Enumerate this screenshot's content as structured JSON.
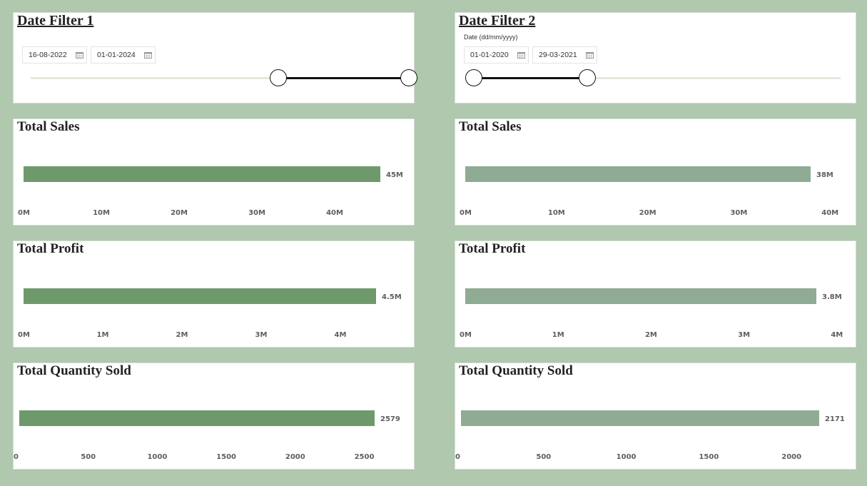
{
  "filters": [
    {
      "title": "Date Filter 1",
      "caption": "",
      "start_date": "16-08-2022",
      "end_date": "01-01-2024",
      "range_fraction": [
        0.655,
        1.0
      ]
    },
    {
      "title": "Date Filter 2",
      "caption": "Date (dd/mm/yyyy)",
      "start_date": "01-01-2020",
      "end_date": "29-03-2021",
      "range_fraction": [
        0.0,
        0.31
      ]
    }
  ],
  "icons": {
    "calendar": "calendar-icon"
  },
  "colors": {
    "background": "#afc8ae",
    "bar_left": "#6e9a6b",
    "bar_right": "#8fab94",
    "slider_fill": "#111111",
    "slider_track": "#e8e6dc"
  },
  "chart_data": [
    {
      "type": "bar",
      "title": "Total Sales",
      "values": [
        45000000
      ],
      "value_label": "45M",
      "xlim": [
        0,
        45000000
      ],
      "ticks": [
        0,
        10000000,
        20000000,
        30000000,
        40000000
      ],
      "tick_labels": [
        "0M",
        "10M",
        "20M",
        "30M",
        "40M"
      ],
      "color": "#6e9a6b"
    },
    {
      "type": "bar",
      "title": "Total Sales",
      "values": [
        38000000
      ],
      "value_label": "38M",
      "xlim": [
        0,
        38000000
      ],
      "ticks": [
        0,
        10000000,
        20000000,
        30000000,
        40000000
      ],
      "tick_labels": [
        "0M",
        "10M",
        "20M",
        "30M",
        "40M"
      ],
      "color": "#8fab94"
    },
    {
      "type": "bar",
      "title": "Total Profit",
      "values": [
        4500000
      ],
      "value_label": "4.5M",
      "xlim": [
        0,
        4500000
      ],
      "ticks": [
        0,
        1000000,
        2000000,
        3000000,
        4000000
      ],
      "tick_labels": [
        "0M",
        "1M",
        "2M",
        "3M",
        "4M"
      ],
      "color": "#6e9a6b"
    },
    {
      "type": "bar",
      "title": "Total Profit",
      "values": [
        3800000
      ],
      "value_label": "3.8M",
      "xlim": [
        0,
        3800000
      ],
      "ticks": [
        0,
        1000000,
        2000000,
        3000000,
        4000000
      ],
      "tick_labels": [
        "0M",
        "1M",
        "2M",
        "3M",
        "4M"
      ],
      "color": "#8fab94"
    },
    {
      "type": "bar",
      "title": "Total Quantity Sold",
      "values": [
        2579
      ],
      "value_label": "2579",
      "xlim": [
        0,
        2579
      ],
      "ticks": [
        0,
        500,
        1000,
        1500,
        2000,
        2500
      ],
      "tick_labels": [
        "0",
        "500",
        "1000",
        "1500",
        "2000",
        "2500"
      ],
      "color": "#6e9a6b"
    },
    {
      "type": "bar",
      "title": "Total Quantity Sold",
      "values": [
        2171
      ],
      "value_label": "2171",
      "xlim": [
        0,
        2171
      ],
      "ticks": [
        0,
        500,
        1000,
        1500,
        2000
      ],
      "tick_labels": [
        "0",
        "500",
        "1000",
        "1500",
        "2000"
      ],
      "color": "#8fab94"
    }
  ]
}
